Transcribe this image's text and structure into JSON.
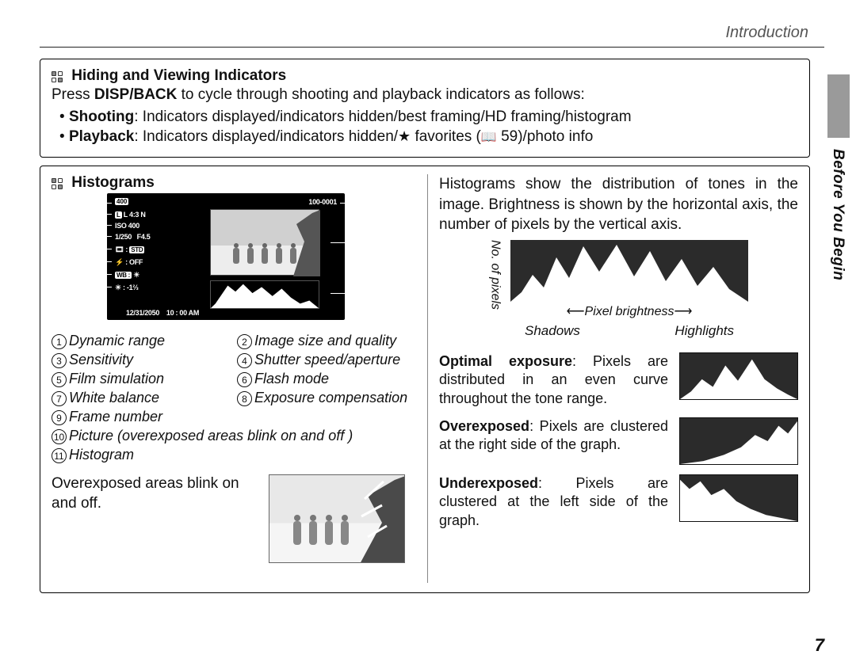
{
  "header": {
    "title": "Introduction"
  },
  "sidebar": {
    "section_label": "Before You Begin"
  },
  "page_number": "7",
  "box1": {
    "heading": "Hiding and Viewing Indicators",
    "intro_prefix": "Press ",
    "intro_bold": "DISP/BACK",
    "intro_suffix": " to cycle through shooting and playback indicators as follows:",
    "bullet1_label": "Shooting",
    "bullet1_value": ": Indicators displayed/indicators hidden/best framing/HD framing/histogram",
    "bullet2_label": "Playback",
    "bullet2_value_a": ": Indicators displayed/indicators hidden/",
    "bullet2_value_b": " favorites (",
    "bullet2_page": " 59)/photo info"
  },
  "box2": {
    "heading": "Histograms",
    "lcd": {
      "dr": "400",
      "size": "L 4:3 N",
      "iso": "ISO 400",
      "shutter": "1/250",
      "aperture": "F4.5",
      "film": "STD",
      "flash_off": ": OFF",
      "wb": "WB :",
      "ev": ": -1⅔",
      "frame": "100-0001",
      "date": "12/31/2050",
      "time": "10 : 00  AM"
    },
    "legend": [
      "Dynamic range",
      "Image size and quality",
      "Sensitivity",
      "Shutter speed/aperture",
      "Film simulation",
      "Flash mode",
      "White balance",
      "Exposure compensation",
      "Frame number"
    ],
    "legend_full1": "Picture (overexposed areas blink on and off )",
    "legend_full2": "Histogram",
    "overexp_text": "Overexposed areas blink on and off.",
    "right_intro": "Histograms show the distribution of tones in the image.  Brightness is shown by the horizontal axis, the number of pixels by the vertical axis.",
    "axis": {
      "y": "No. of\npixels",
      "x": "Pixel brightness",
      "shadows": "Shadows",
      "highlights": "Highlights"
    },
    "optimal_label": "Optimal exposure",
    "optimal_text": ": Pixels are distributed in an even curve throughout the tone range.",
    "over_label": "Overexposed",
    "over_text": ": Pixels are clustered at the right side of the graph.",
    "under_label": "Underexposed",
    "under_text": ": Pixels are clustered at the left side of the graph."
  }
}
